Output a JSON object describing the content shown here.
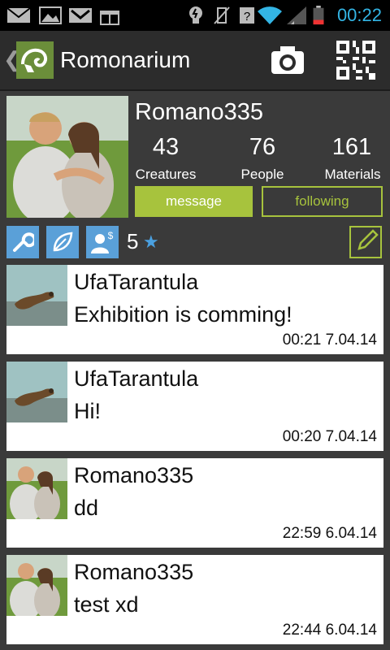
{
  "status_bar": {
    "time": "00:22",
    "icons": [
      "mail-icon",
      "image-icon",
      "gmail-icon",
      "gift-icon",
      "bulb-icon",
      "vibrate-off-icon",
      "nfc-icon",
      "wifi-icon",
      "signal-icon",
      "battery-icon"
    ],
    "accent": "#33b5e5"
  },
  "action_bar": {
    "title": "Romonarium",
    "back_glyph": "❮",
    "icons": [
      "back-icon",
      "chameleon-logo-icon",
      "camera-icon",
      "qr-code-icon"
    ]
  },
  "profile": {
    "username": "Romano335",
    "stats": [
      {
        "count": "43",
        "label": "Creatures"
      },
      {
        "count": "76",
        "label": "People"
      },
      {
        "count": "161",
        "label": "Materials"
      }
    ],
    "message_label": "message",
    "following_label": "following",
    "accent": "#a7c33d"
  },
  "badges": {
    "icons": [
      "wrench-icon",
      "leaf-icon",
      "user-dollar-icon"
    ],
    "rating": "5",
    "star": "★",
    "badge_color": "#5aa0d8"
  },
  "feed": [
    {
      "user": "UfaTarantula",
      "text": "Exhibition is comming!",
      "time": "00:21 7.04.14",
      "thumb": "lizard"
    },
    {
      "user": "UfaTarantula",
      "text": "Hi!",
      "time": "00:20 7.04.14",
      "thumb": "lizard"
    },
    {
      "user": "Romano335",
      "text": "dd",
      "time": "22:59 6.04.14",
      "thumb": "couple"
    },
    {
      "user": "Romano335",
      "text": "test xd",
      "time": "22:44 6.04.14",
      "thumb": "couple"
    }
  ]
}
